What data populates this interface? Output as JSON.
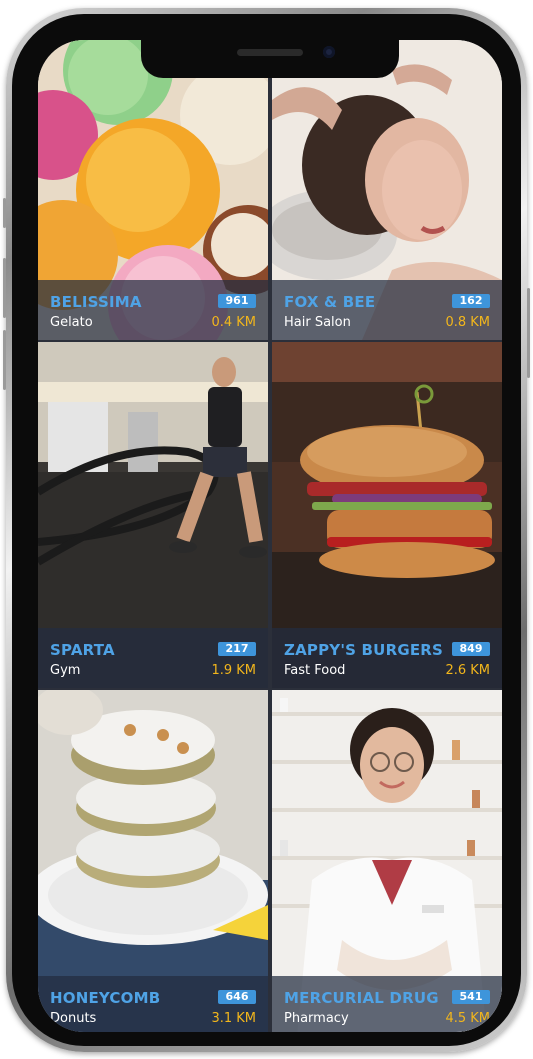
{
  "tiles": [
    {
      "name": "BELISSIMA",
      "category": "Gelato",
      "count": "961",
      "distance": "0.4 KM"
    },
    {
      "name": "FOX & BEE",
      "category": "Hair Salon",
      "count": "162",
      "distance": "0.8 KM"
    },
    {
      "name": "SPARTA",
      "category": "Gym",
      "count": "217",
      "distance": "1.9 KM"
    },
    {
      "name": "ZAPPY'S BURGERS",
      "category": "Fast Food",
      "count": "849",
      "distance": "2.6 KM"
    },
    {
      "name": "HONEYCOMB",
      "category": "Donuts",
      "count": "646",
      "distance": "3.1 KM"
    },
    {
      "name": "MERCURIAL DRUG",
      "category": "Pharmacy",
      "count": "541",
      "distance": "4.5 KM"
    }
  ],
  "colors": {
    "name": "#4fa3e6",
    "badge": "#3e95db",
    "distance": "#f2b61c",
    "caption": "#232c40"
  }
}
